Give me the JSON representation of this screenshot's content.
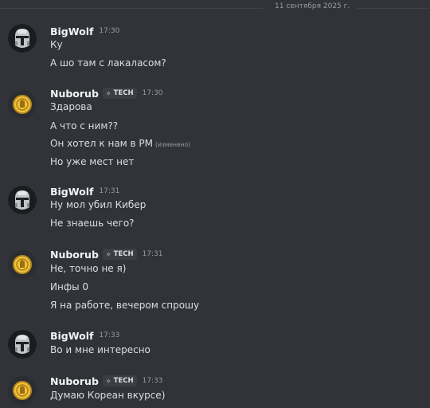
{
  "date_divider": "11 сентября 2025 г.",
  "colors": {
    "background": "#323339",
    "text": "#dbdee1",
    "username": "#f2f3f5",
    "muted": "#949ba4",
    "tag_bg": "#3d3e45"
  },
  "groups": [
    {
      "author": "BigWolf",
      "avatar_icon": "mandalorian-helmet-icon",
      "time": "17:30",
      "messages": [
        {
          "text": "Ку"
        },
        {
          "text": "А шо там с лакаласом?"
        }
      ]
    },
    {
      "author": "Nuborub",
      "avatar_icon": "gold-coin-icon",
      "tag": "TECH",
      "tag_icon": "diamond-icon",
      "time": "17:30",
      "messages": [
        {
          "text": "Здарова"
        },
        {
          "text": "А что с ним??"
        },
        {
          "text": "Он хотел к нам в РМ",
          "edited": "(изменено)"
        },
        {
          "text": "Но уже мест нет"
        }
      ]
    },
    {
      "author": "BigWolf",
      "avatar_icon": "mandalorian-helmet-icon",
      "time": "17:31",
      "messages": [
        {
          "text": "Ну мол убил Кибер"
        },
        {
          "text": "Не знаешь чего?"
        }
      ]
    },
    {
      "author": "Nuborub",
      "avatar_icon": "gold-coin-icon",
      "tag": "TECH",
      "tag_icon": "diamond-icon",
      "time": "17:31",
      "messages": [
        {
          "text": "Не, точно не я)"
        },
        {
          "text": "Инфы 0"
        },
        {
          "text": "Я на работе, вечером спрошу"
        }
      ]
    },
    {
      "author": "BigWolf",
      "avatar_icon": "mandalorian-helmet-icon",
      "time": "17:33",
      "messages": [
        {
          "text": "Во и мне интересно"
        }
      ]
    },
    {
      "author": "Nuborub",
      "avatar_icon": "gold-coin-icon",
      "tag": "TECH",
      "tag_icon": "diamond-icon",
      "time": "17:33",
      "messages": [
        {
          "text": "Думаю Кореан вкурсе)"
        }
      ]
    }
  ]
}
